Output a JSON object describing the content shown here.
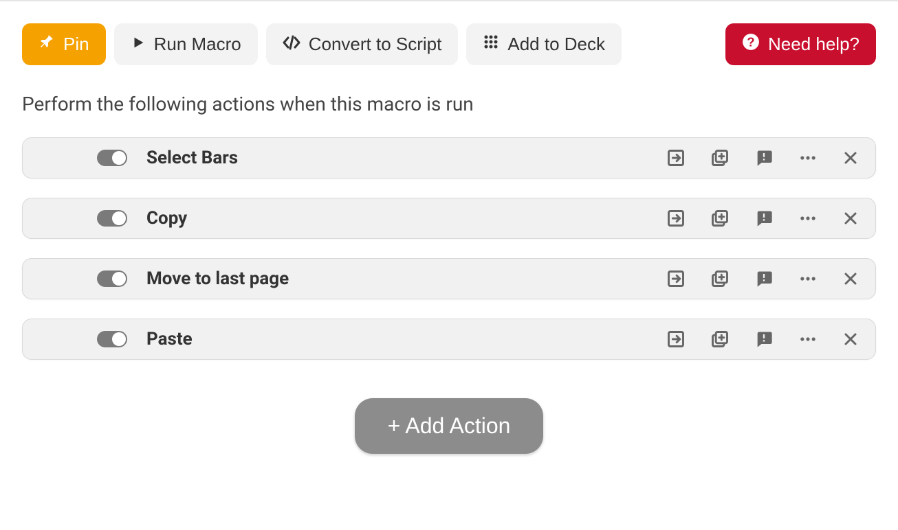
{
  "toolbar": {
    "pin_label": "Pin",
    "run_label": "Run Macro",
    "convert_label": "Convert to Script",
    "deck_label": "Add to Deck",
    "help_label": "Need help?"
  },
  "instruction": "Perform the following actions when this macro is run",
  "actions": [
    {
      "label": "Select Bars"
    },
    {
      "label": "Copy"
    },
    {
      "label": "Move to last page"
    },
    {
      "label": "Paste"
    }
  ],
  "add_action_label": "+ Add Action"
}
